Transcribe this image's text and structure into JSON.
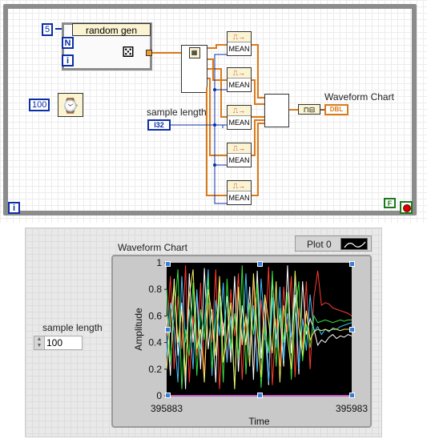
{
  "block_diagram": {
    "random_gen_label": "random gen",
    "loop_count_constant": "5",
    "n_terminal": "N",
    "i_terminal": "i",
    "wait_constant": "100",
    "sample_length_label": "sample length",
    "sample_length_type": "I32",
    "mean_label": "MEAN",
    "waveform_chart_label": "Waveform Chart",
    "waveform_chart_type": "DBL",
    "stop_terminal": "F",
    "loop_index": "i"
  },
  "front_panel": {
    "sample_length_label": "sample length",
    "sample_length_value": "100",
    "chart_title": "Waveform Chart",
    "legend_label": "Plot 0"
  },
  "chart_data": {
    "type": "line",
    "title": "Waveform Chart",
    "xlabel": "Time",
    "ylabel": "Amplitude",
    "x_ticks": [
      "395883",
      "395983"
    ],
    "y_ticks": [
      "0",
      "0.2",
      "0.4",
      "0.6",
      "0.8",
      "1"
    ],
    "xlim": [
      395883,
      395983
    ],
    "ylim": [
      0,
      1
    ],
    "background": "#000000",
    "series": [
      {
        "color": "#ff3b30",
        "values": [
          0.45,
          0.9,
          0.2,
          0.75,
          0.35,
          0.98,
          0.1,
          0.6,
          0.3,
          0.85,
          0.15,
          0.7,
          0.4,
          0.95,
          0.05,
          0.55,
          0.25,
          0.8,
          0.45,
          0.92,
          0.12,
          0.62,
          0.33,
          0.88,
          0.18,
          0.72,
          0.42,
          0.97,
          0.08,
          0.58,
          0.22,
          0.82,
          0.48,
          0.9,
          0.14,
          0.66,
          0.36,
          0.86,
          0.2,
          0.74,
          0.94,
          0.68,
          0.7,
          0.69,
          0.66,
          0.65,
          0.64,
          0.63,
          0.62,
          0.6
        ]
      },
      {
        "color": "#ffffff",
        "values": [
          0.6,
          0.15,
          0.88,
          0.3,
          0.7,
          0.05,
          0.92,
          0.4,
          0.78,
          0.2,
          0.96,
          0.35,
          0.65,
          0.1,
          0.85,
          0.45,
          0.75,
          0.25,
          0.9,
          0.18,
          0.68,
          0.38,
          0.82,
          0.12,
          0.94,
          0.28,
          0.72,
          0.08,
          0.88,
          0.42,
          0.62,
          0.22,
          0.98,
          0.32,
          0.76,
          0.16,
          0.86,
          0.46,
          0.58,
          0.5,
          0.38,
          0.42,
          0.4,
          0.44,
          0.46,
          0.43,
          0.45,
          0.44,
          0.46,
          0.45
        ]
      },
      {
        "color": "#3fbfff",
        "values": [
          0.3,
          0.7,
          0.5,
          0.1,
          0.9,
          0.4,
          0.65,
          0.2,
          0.8,
          0.35,
          0.55,
          0.95,
          0.15,
          0.72,
          0.45,
          0.85,
          0.25,
          0.6,
          0.05,
          0.78,
          0.4,
          0.92,
          0.3,
          0.68,
          0.18,
          0.88,
          0.5,
          0.1,
          0.74,
          0.36,
          0.82,
          0.26,
          0.62,
          0.44,
          0.9,
          0.2,
          0.58,
          0.34,
          0.76,
          0.48,
          0.52,
          0.46,
          0.5,
          0.48,
          0.51,
          0.5,
          0.52,
          0.53,
          0.54,
          0.55
        ]
      },
      {
        "color": "#35e03a",
        "values": [
          0.8,
          0.25,
          0.6,
          0.95,
          0.05,
          0.5,
          0.3,
          0.85,
          0.15,
          0.65,
          0.42,
          0.9,
          0.2,
          0.55,
          0.75,
          0.1,
          0.88,
          0.35,
          0.62,
          0.28,
          0.98,
          0.16,
          0.7,
          0.46,
          0.84,
          0.06,
          0.52,
          0.32,
          0.94,
          0.22,
          0.66,
          0.4,
          0.78,
          0.12,
          0.6,
          0.86,
          0.26,
          0.54,
          0.36,
          0.6,
          0.55,
          0.56,
          0.57,
          0.56,
          0.55,
          0.56,
          0.57,
          0.56,
          0.57,
          0.57
        ]
      },
      {
        "color": "#f2ee5a",
        "values": [
          0.2,
          0.55,
          0.85,
          0.4,
          0.65,
          0.15,
          0.75,
          0.95,
          0.35,
          0.5,
          0.1,
          0.8,
          0.6,
          0.3,
          0.9,
          0.25,
          0.45,
          0.7,
          0.05,
          0.82,
          0.38,
          0.6,
          0.22,
          0.92,
          0.48,
          0.14,
          0.76,
          0.56,
          0.32,
          0.86,
          0.1,
          0.68,
          0.44,
          0.2,
          0.94,
          0.52,
          0.3,
          0.64,
          0.42,
          0.48,
          0.5,
          0.49,
          0.5,
          0.49,
          0.5,
          0.5,
          0.49,
          0.5,
          0.5,
          0.5
        ]
      }
    ]
  }
}
